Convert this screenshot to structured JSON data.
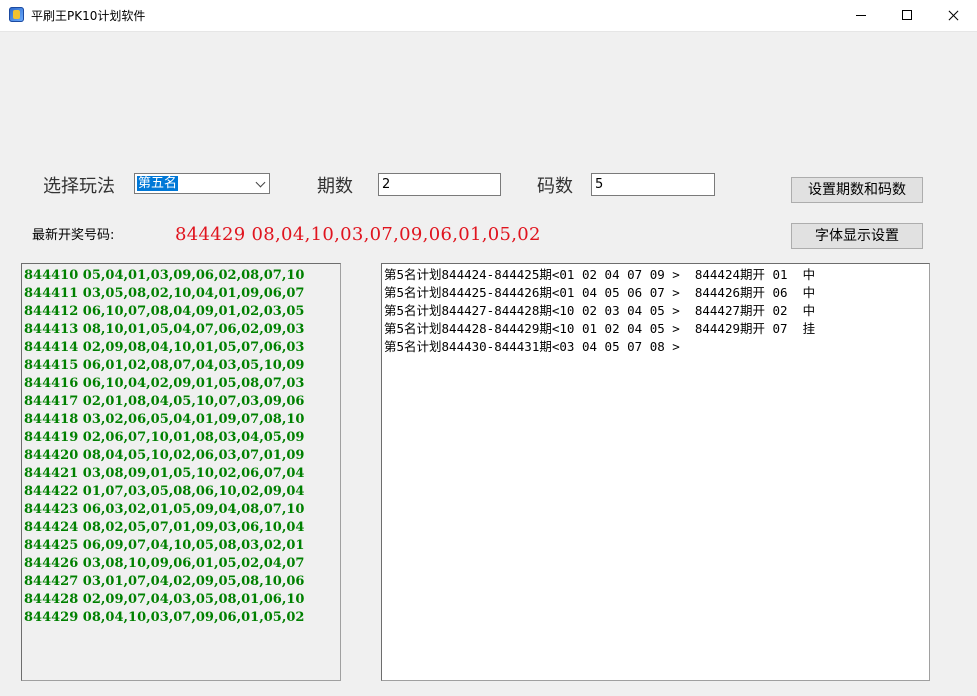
{
  "window": {
    "title": "平刷王PK10计划软件"
  },
  "controls": {
    "mode_label": "选择玩法",
    "mode_value": "第五名",
    "periods_label": "期数",
    "periods_value": "2",
    "codes_label": "码数",
    "codes_value": "5",
    "set_button": "设置期数和码数",
    "font_button": "字体显示设置"
  },
  "latest": {
    "label": "最新开奖号码:",
    "value": "844429  08,04,10,03,07,09,06,01,05,02"
  },
  "history": [
    "844410 05,04,01,03,09,06,02,08,07,10",
    "844411 03,05,08,02,10,04,01,09,06,07",
    "844412 06,10,07,08,04,09,01,02,03,05",
    "844413 08,10,01,05,04,07,06,02,09,03",
    "844414 02,09,08,04,10,01,05,07,06,03",
    "844415 06,01,02,08,07,04,03,05,10,09",
    "844416 06,10,04,02,09,01,05,08,07,03",
    "844417 02,01,08,04,05,10,07,03,09,06",
    "844418 03,02,06,05,04,01,09,07,08,10",
    "844419 02,06,07,10,01,08,03,04,05,09",
    "844420 08,04,05,10,02,06,03,07,01,09",
    "844421 03,08,09,01,05,10,02,06,07,04",
    "844422 01,07,03,05,08,06,10,02,09,04",
    "844423 06,03,02,01,05,09,04,08,07,10",
    "844424 08,02,05,07,01,09,03,06,10,04",
    "844425 06,09,07,04,10,05,08,03,02,01",
    "844426 03,08,10,09,06,01,05,02,04,07",
    "844427 03,01,07,04,02,09,05,08,10,06",
    "844428 02,09,07,04,03,05,08,01,06,10",
    "844429 08,04,10,03,07,09,06,01,05,02"
  ],
  "plans": [
    "第5名计划844424-844425期<01 02 04 07 09 >  844424期开 01  中",
    "第5名计划844425-844426期<01 04 05 06 07 >  844426期开 06  中",
    "第5名计划844427-844428期<10 02 03 04 05 >  844427期开 02  中",
    "第5名计划844428-844429期<10 01 02 04 05 >  844429期开 07  挂",
    "第5名计划844430-844431期<03 04 05 07 08 >"
  ]
}
